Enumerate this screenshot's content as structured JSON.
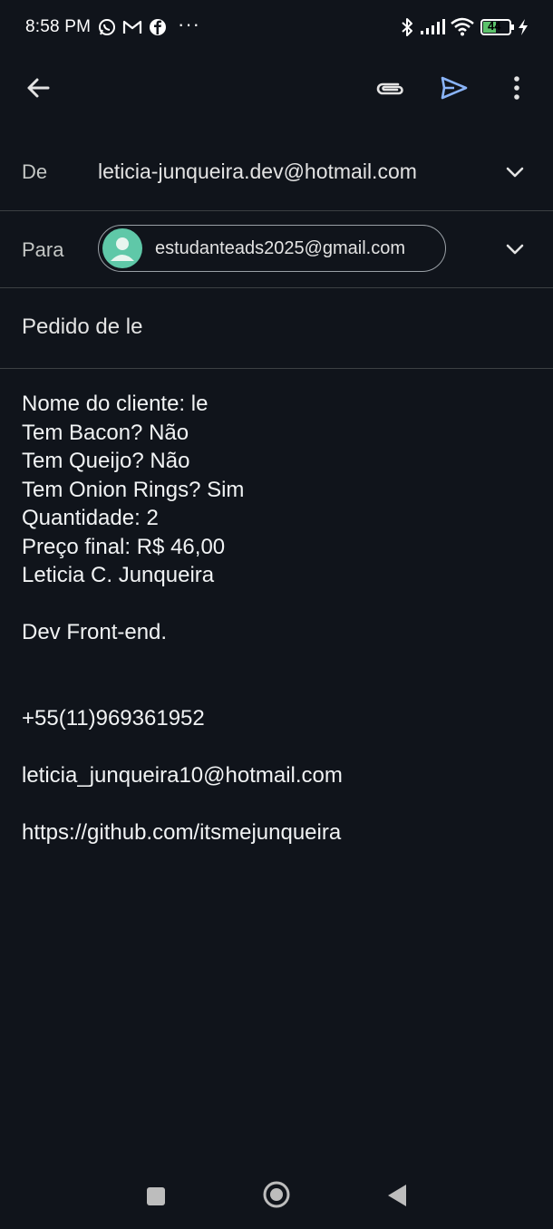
{
  "status_bar": {
    "time": "8:58 PM",
    "left_icons": [
      "whatsapp-icon",
      "gmail-icon",
      "facebook-icon"
    ],
    "overflow": "···",
    "right_icons": [
      "bluetooth-icon",
      "signal-icon",
      "wifi-icon",
      "battery-icon",
      "charging-icon"
    ],
    "battery_level": "44"
  },
  "toolbar": {
    "back_icon": "arrow-left-icon",
    "attach_icon": "paperclip-icon",
    "send_icon": "send-icon",
    "more_icon": "more-vert-icon",
    "accent_color": "#8ab4f8"
  },
  "compose": {
    "from_label": "De",
    "from_value": "leticia-junqueira.dev@hotmail.com",
    "to_label": "Para",
    "to_recipient": "estudanteads2025@gmail.com",
    "subject": "Pedido de le",
    "body_lines": [
      "Nome do cliente: le",
      "Tem Bacon? Não",
      "Tem Queijo? Não",
      "Tem Onion Rings? Sim",
      "Quantidade: 2",
      "Preço final: R$ 46,00",
      "Leticia C. Junqueira",
      "Dev Front-end.",
      "+55(11)969361952",
      "leticia_junqueira10@hotmail.com",
      "https://github.com/itsmejunqueira"
    ]
  },
  "nav_bar": {
    "icons": [
      "recents-square-icon",
      "home-circle-icon",
      "back-triangle-icon"
    ]
  }
}
